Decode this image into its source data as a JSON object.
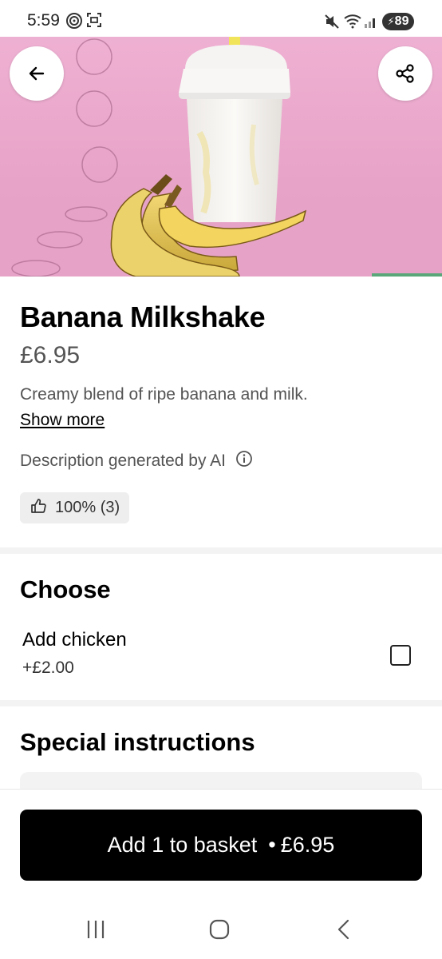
{
  "status_bar": {
    "time": "5:59",
    "battery": "89",
    "icons": [
      "radar-icon",
      "screenshot-icon",
      "mute-icon",
      "wifi-icon",
      "signal-icon",
      "charging-icon"
    ]
  },
  "hero": {
    "background_color": "#e9a7c9",
    "back_icon": "arrow-left-icon",
    "share_icon": "share-icon"
  },
  "product": {
    "title": "Banana Milkshake",
    "price": "£6.95",
    "description": "Creamy blend of ripe banana and milk.",
    "show_more_label": "Show more",
    "ai_note": "Description generated by AI",
    "info_icon": "info-icon",
    "rating": "100% (3)",
    "rating_icon": "thumbs-up-icon"
  },
  "choose": {
    "title": "Choose",
    "options": [
      {
        "label": "Add chicken",
        "price": "+£2.00",
        "checked": false
      }
    ]
  },
  "special_instructions": {
    "title": "Special instructions",
    "value": "",
    "placeholder": ""
  },
  "cart_button": {
    "label": "Add 1 to basket",
    "separator": "•",
    "price": "£6.95"
  },
  "nav_bar": {
    "buttons": [
      "recents-icon",
      "home-icon",
      "back-icon"
    ]
  }
}
